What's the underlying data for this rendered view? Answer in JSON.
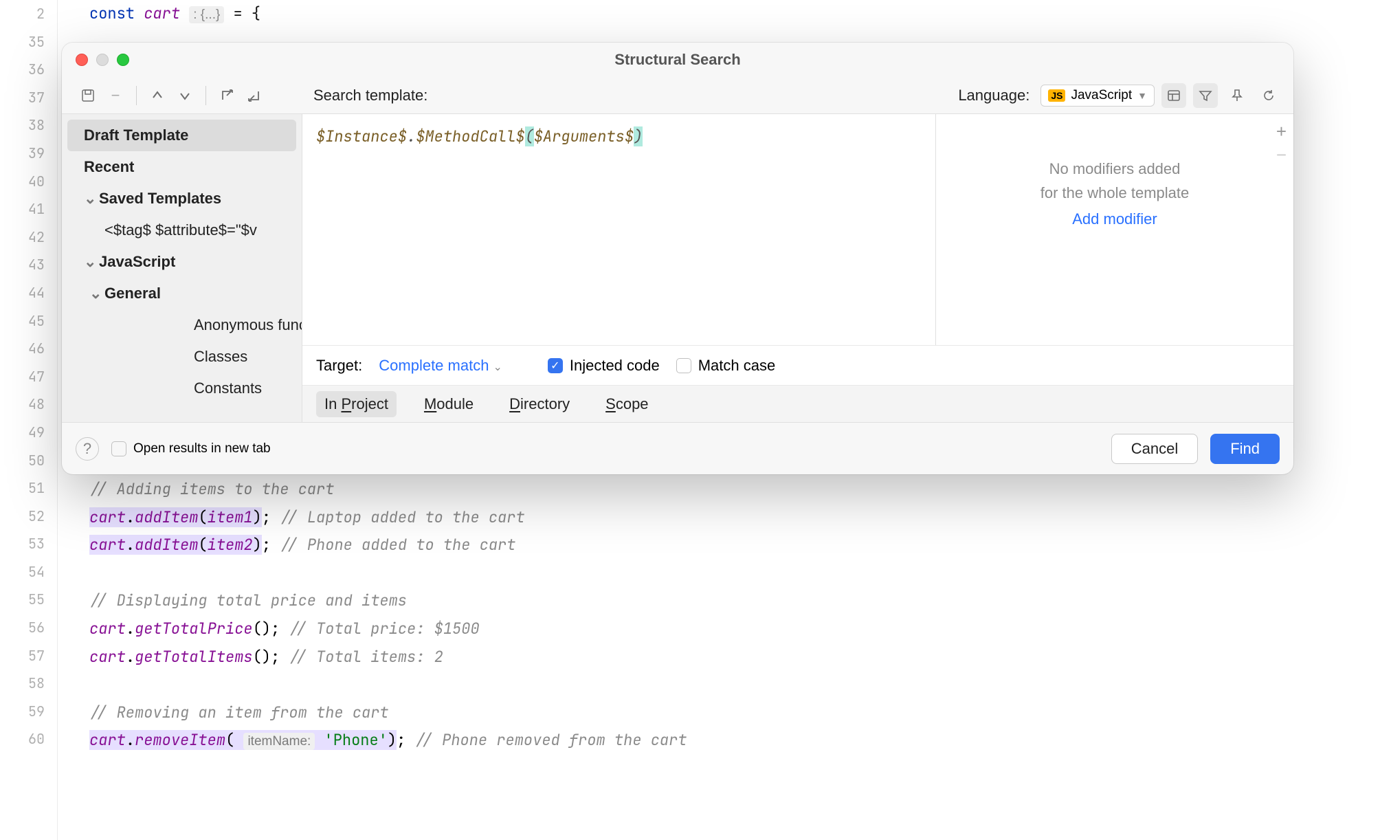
{
  "editor": {
    "gutter": [
      "2",
      "35",
      "36",
      "37",
      "38",
      "39",
      "40",
      "41",
      "42",
      "43",
      "44",
      "45",
      "46",
      "47",
      "48",
      "49",
      "50",
      "51",
      "52",
      "53",
      "54",
      "55",
      "56",
      "57",
      "58",
      "59",
      "60"
    ],
    "line2": {
      "kw": "const",
      "ident": "cart",
      "hint": ": {...}",
      "rest": " = {"
    },
    "line51": "// Adding items to the cart",
    "line52": {
      "obj": "cart",
      "m": "addItem",
      "arg": "item1",
      "tail": "; ",
      "c": "// Laptop added to the cart"
    },
    "line53": {
      "obj": "cart",
      "m": "addItem",
      "arg": "item2",
      "tail": "; ",
      "c": "// Phone added to the cart"
    },
    "line55": "// Displaying total price and items",
    "line56": {
      "obj": "cart",
      "m": "getTotalPrice",
      "tail": "(); ",
      "c": "// Total price: $1500"
    },
    "line57": {
      "obj": "cart",
      "m": "getTotalItems",
      "tail": "(); ",
      "c": "// Total items: 2"
    },
    "line59": "// Removing an item from the cart",
    "line60": {
      "obj": "cart",
      "m": "removeItem",
      "hint": "itemName:",
      "arg": "'Phone'",
      "tail": "; ",
      "c": "// Phone removed from the cart"
    }
  },
  "dialog": {
    "title": "Structural Search",
    "search_template_label": "Search template:",
    "language_label": "Language:",
    "language_value": "JavaScript",
    "js_badge": "JS",
    "template": {
      "p1": "$Instance$",
      "dot": ".",
      "p2": "$MethodCall$",
      "paren_open": "(",
      "p3": "$Arguments$",
      "paren_close": ")"
    },
    "modifiers": {
      "line1": "No modifiers added",
      "line2": "for the whole template",
      "add": "Add modifier"
    },
    "target_label": "Target:",
    "target_value": "Complete match",
    "injected_label": "Injected code",
    "matchcase_label": "Match case",
    "scope": {
      "project": {
        "pre": "In ",
        "u": "P",
        "post": "roject"
      },
      "module": {
        "u": "M",
        "post": "odule"
      },
      "directory": {
        "u": "D",
        "post": "irectory"
      },
      "scope": {
        "u": "S",
        "post": "cope"
      }
    },
    "open_tab_label": "Open results in new tab",
    "cancel": "Cancel",
    "find": "Find"
  },
  "sidebar": {
    "draft": "Draft Template",
    "recent": "Recent",
    "saved": "Saved Templates",
    "saved_item": "<$tag$ $attribute$=\"$v",
    "javascript": "JavaScript",
    "general": "General",
    "gen_items": [
      "Anonymous functions",
      "Classes",
      "Constants"
    ]
  }
}
